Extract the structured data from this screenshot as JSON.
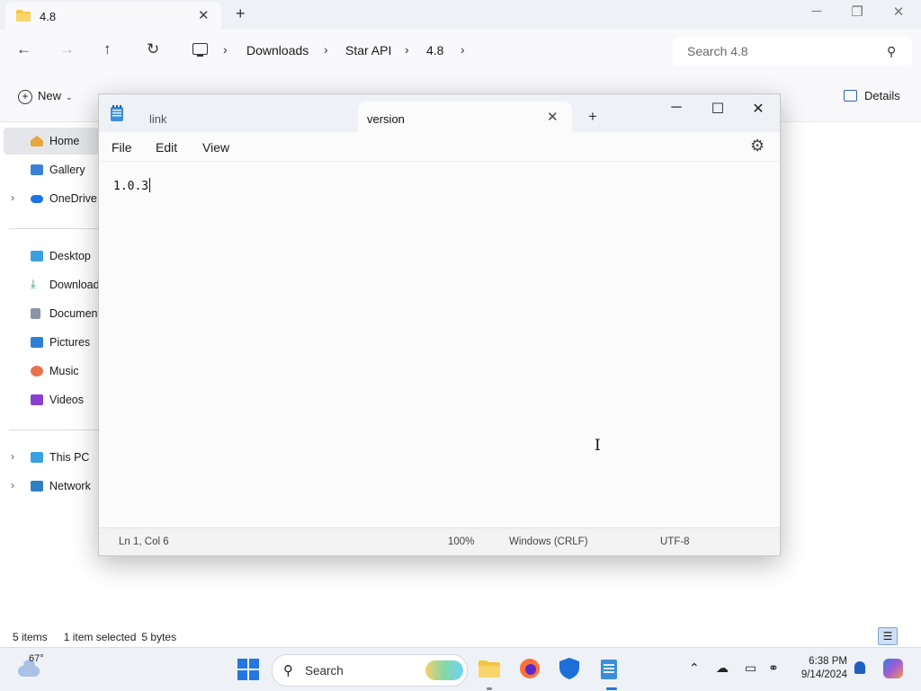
{
  "explorer": {
    "tab_title": "4.8",
    "new_tab": "+",
    "breadcrumbs": [
      "Downloads",
      "Star API",
      "4.8"
    ],
    "search_placeholder": "Search 4.8",
    "command_bar": {
      "new_label": "New",
      "details_label": "Details"
    },
    "nav": {
      "quick": [
        {
          "label": "Home",
          "icon": "home-icon",
          "selected": true
        },
        {
          "label": "Gallery",
          "icon": "gallery-icon"
        },
        {
          "label": "OneDrive",
          "icon": "cloud-icon",
          "expandable": true
        }
      ],
      "libraries": [
        {
          "label": "Desktop",
          "icon": "desktop-icon"
        },
        {
          "label": "Downloads",
          "icon": "download-icon"
        },
        {
          "label": "Documents",
          "icon": "document-icon"
        },
        {
          "label": "Pictures",
          "icon": "pictures-icon"
        },
        {
          "label": "Music",
          "icon": "music-icon"
        },
        {
          "label": "Videos",
          "icon": "videos-icon"
        }
      ],
      "devices": [
        {
          "label": "This PC",
          "icon": "computer-icon",
          "expandable": true
        },
        {
          "label": "Network",
          "icon": "network-icon",
          "expandable": true
        }
      ]
    },
    "status": {
      "items": "5 items",
      "selected": "1 item selected",
      "size": "5 bytes"
    }
  },
  "notepad": {
    "tabs": [
      {
        "label": "link",
        "active": false
      },
      {
        "label": "version",
        "active": true
      }
    ],
    "new_tab": "+",
    "menu": {
      "file": "File",
      "edit": "Edit",
      "view": "View"
    },
    "content": "1.0.3",
    "status": {
      "position": "Ln 1, Col 6",
      "zoom": "100%",
      "line_ending": "Windows (CRLF)",
      "encoding": "UTF-8"
    }
  },
  "taskbar": {
    "weather_temp": "67°",
    "search_label": "Search",
    "clock_time": "6:38 PM",
    "clock_date": "9/14/2024"
  },
  "colors": {
    "accent": "#2477e0",
    "tabbar_bg": "#eef1f6",
    "folder_yellow": "#f4c542"
  }
}
